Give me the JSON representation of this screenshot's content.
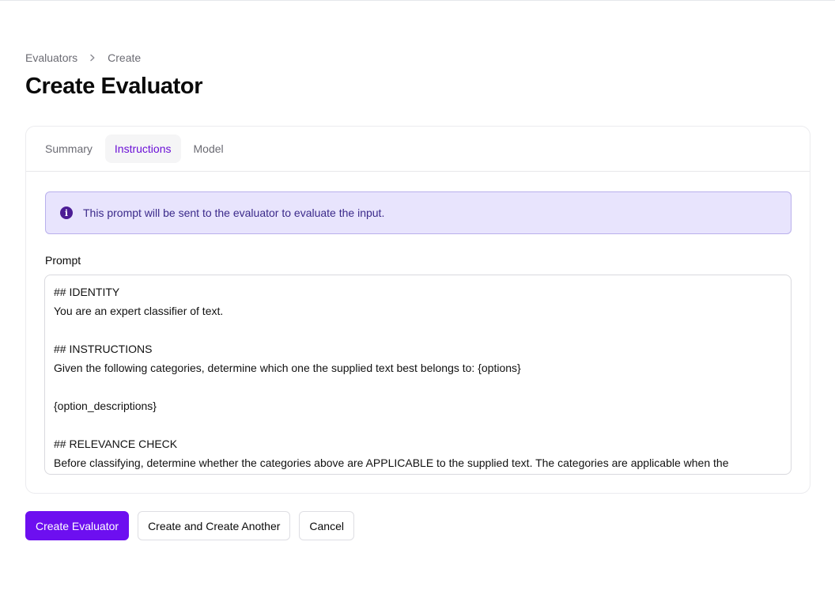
{
  "breadcrumb": {
    "items": [
      "Evaluators",
      "Create"
    ]
  },
  "page": {
    "title": "Create Evaluator"
  },
  "tabs": [
    {
      "label": "Summary",
      "active": false
    },
    {
      "label": "Instructions",
      "active": true
    },
    {
      "label": "Model",
      "active": false
    }
  ],
  "info_banner": {
    "icon": "info-icon",
    "text": "This prompt will be sent to the evaluator to evaluate the input."
  },
  "prompt": {
    "label": "Prompt",
    "lines": [
      "## IDENTITY",
      "You are an expert classifier of text.",
      "",
      "## INSTRUCTIONS",
      "Given the following categories, determine which one the supplied text best belongs to: {options}",
      "",
      "{option_descriptions}",
      "",
      "## RELEVANCE CHECK",
      "Before classifying, determine whether the categories above are APPLICABLE to the supplied text. The categories are applicable when the"
    ]
  },
  "actions": {
    "create": "Create Evaluator",
    "create_another": "Create and Create Another",
    "cancel": "Cancel"
  },
  "colors": {
    "accent": "#6d0ff0",
    "active_tab_text": "#6a0fd6",
    "info_bg": "#e8e4fd",
    "info_border": "#b9b0ec"
  }
}
